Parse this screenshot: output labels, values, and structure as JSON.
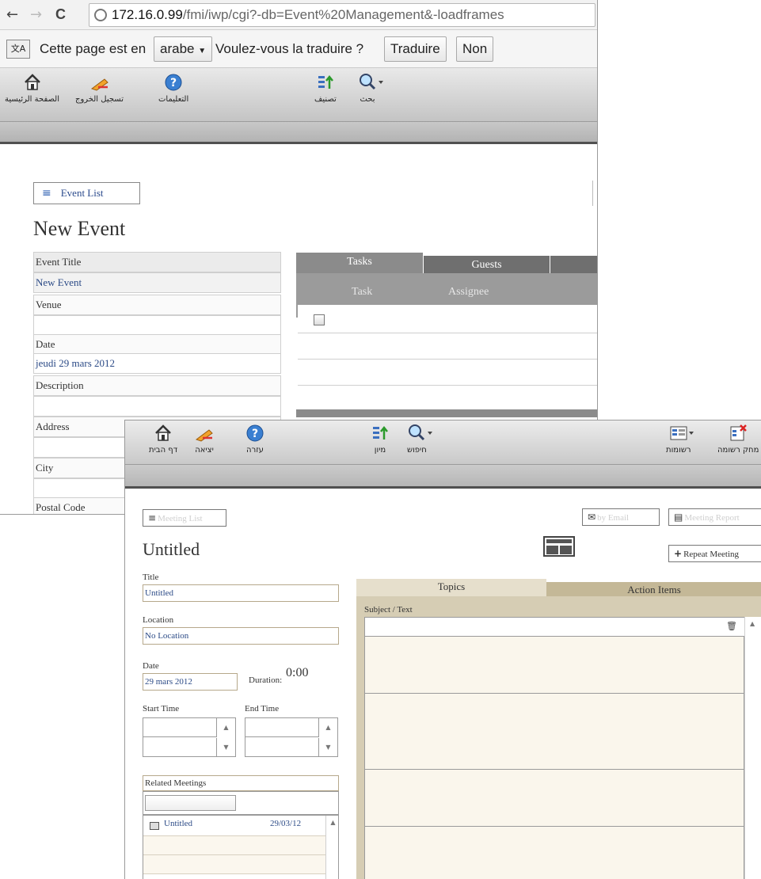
{
  "browser": {
    "back_glyph": "←",
    "forward_glyph": "→",
    "reload_glyph": "C",
    "url_host": "172.16.0.99",
    "url_path": "/fmi/iwp/cgi?-db=Event%20Management&-loadframes"
  },
  "translate_bar": {
    "icon_text": "文A",
    "prefix": "Cette page est en",
    "language": "arabe",
    "question": "Voulez-vous la traduire ?",
    "translate_button": "Traduire",
    "no_button": "Non"
  },
  "window1": {
    "toolbar": {
      "home": "الصفحة الرئيسية",
      "logout": "تسجيل الخروج",
      "help": "التعليمات",
      "sort": "تصنيف",
      "search": "بحث"
    },
    "event_list_button": "Event List",
    "page_title": "New Event",
    "fields": {
      "event_title_label": "Event Title",
      "event_title_value": "New Event",
      "venue_label": "Venue",
      "date_label": "Date",
      "date_value": "jeudi 29 mars 2012",
      "description_label": "Description",
      "address_label": "Address",
      "city_label": "City",
      "postal_code_label": "Postal Code"
    },
    "tabs": {
      "tasks": "Tasks",
      "guests": "Guests",
      "col_task": "Task",
      "col_assignee": "Assignee"
    }
  },
  "window2": {
    "toolbar": {
      "home": "דף הבית",
      "logout": "יציאה",
      "help": "עזרה",
      "sort": "מיון",
      "search": "חיפוש",
      "records": "רשומות",
      "delete_record": "מחק רשומה"
    },
    "meeting_list_button": "Meeting List",
    "email_button": "by Email",
    "report_button": "Meeting Report",
    "repeat_meeting_button": "Repeat Meeting",
    "page_title": "Untitled",
    "title_label": "Title",
    "title_value": "Untitled",
    "location_label": "Location",
    "location_value": "No Location",
    "date_label": "Date",
    "date_value": "29 mars 2012",
    "duration_label": "Duration:",
    "duration_value": "0:00",
    "start_time_label": "Start Time",
    "end_time_label": "End Time",
    "related_meetings_label": "Related Meetings",
    "related_meetings": [
      {
        "name": "Untitled",
        "date": "29/03/12"
      }
    ],
    "tabs": {
      "topics": "Topics",
      "action_items": "Action Items",
      "subject_text": "Subject / Text"
    }
  },
  "colors": {
    "link_blue": "#2b4a86",
    "toolbar_gray": "#c9c9c9",
    "tab_tan": "#d6cdb4"
  }
}
